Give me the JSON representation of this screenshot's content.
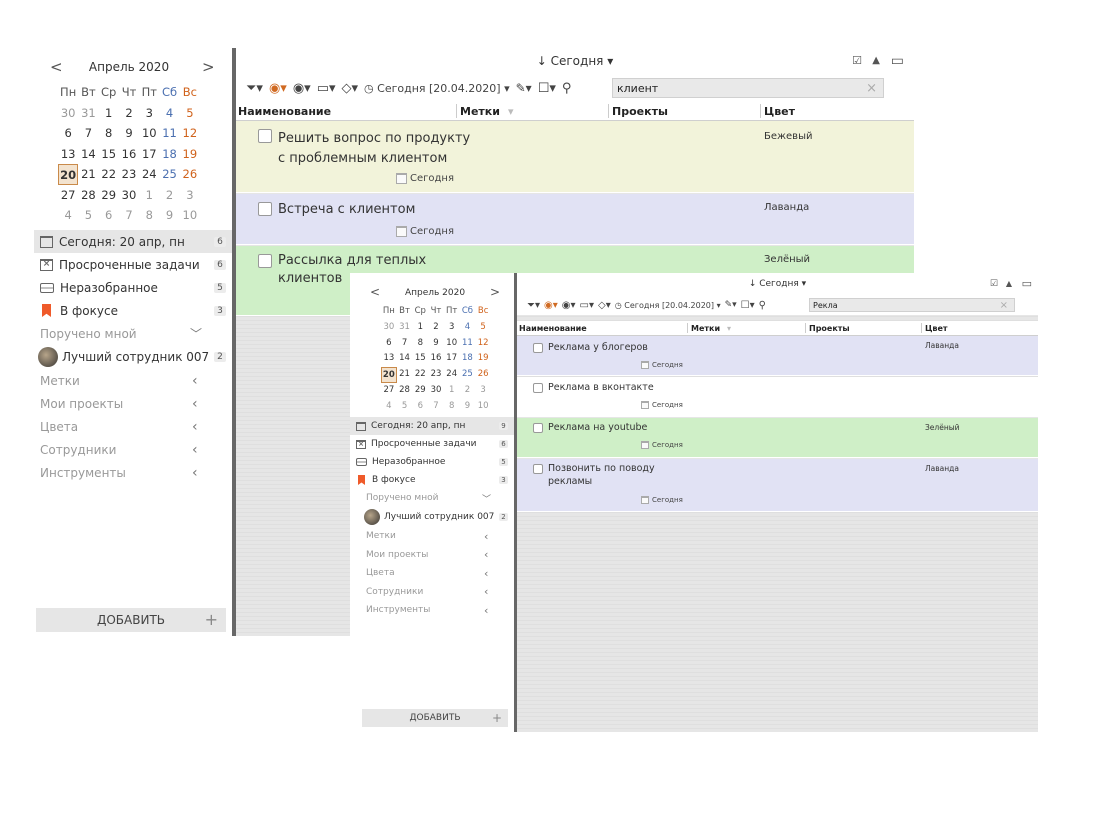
{
  "w1": {
    "calendar": {
      "month": "Апрель 2020",
      "weekdays": [
        "Пн",
        "Вт",
        "Ср",
        "Чт",
        "Пт",
        "Сб",
        "Вс"
      ],
      "weeks": [
        [
          "30",
          "31",
          "1",
          "2",
          "3",
          "4",
          "5"
        ],
        [
          "6",
          "7",
          "8",
          "9",
          "10",
          "11",
          "12"
        ],
        [
          "13",
          "14",
          "15",
          "16",
          "17",
          "18",
          "19"
        ],
        [
          "20",
          "21",
          "22",
          "23",
          "24",
          "25",
          "26"
        ],
        [
          "27",
          "28",
          "29",
          "30",
          "1",
          "2",
          "3"
        ],
        [
          "4",
          "5",
          "6",
          "7",
          "8",
          "9",
          "10"
        ]
      ],
      "today": "20"
    },
    "nav": {
      "today": {
        "label": "Сегодня: 20 апр, пн",
        "count": "6"
      },
      "overdue": {
        "label": "Просроченные задачи",
        "count": "6"
      },
      "inbox": {
        "label": "Неразобранное",
        "count": "5"
      },
      "focus": {
        "label": "В фокусе",
        "count": "3"
      },
      "assigned": "Поручено мной",
      "employee": {
        "label": "Лучший сотрудник 007",
        "count": "2"
      },
      "tags": "Метки",
      "projects": "Мои проекты",
      "colors": "Цвета",
      "staff": "Сотрудники",
      "tools": "Инструменты"
    },
    "add_label": "ДОБАВИТЬ",
    "header": "↓ Сегодня ▾",
    "toolbar": {
      "date_filter": "Сегодня [20.04.2020]",
      "search_value": "клиент"
    },
    "columns": {
      "name": "Наименование",
      "tags": "Метки",
      "projects": "Проекты",
      "color": "Цвет"
    },
    "tasks": [
      {
        "name": "Решить вопрос по продукту\nс проблемным клиентом",
        "date": "Сегодня",
        "color": "Бежевый"
      },
      {
        "name": "Встреча с клиентом",
        "date": "Сегодня",
        "color": "Лаванда"
      },
      {
        "name": "Рассылка для теплых\nклиентов",
        "date": "",
        "color": "Зелёный"
      }
    ]
  },
  "w2": {
    "calendar": {
      "month": "Апрель 2020",
      "weekdays": [
        "Пн",
        "Вт",
        "Ср",
        "Чт",
        "Пт",
        "Сб",
        "Вс"
      ],
      "weeks": [
        [
          "30",
          "31",
          "1",
          "2",
          "3",
          "4",
          "5"
        ],
        [
          "6",
          "7",
          "8",
          "9",
          "10",
          "11",
          "12"
        ],
        [
          "13",
          "14",
          "15",
          "16",
          "17",
          "18",
          "19"
        ],
        [
          "20",
          "21",
          "22",
          "23",
          "24",
          "25",
          "26"
        ],
        [
          "27",
          "28",
          "29",
          "30",
          "1",
          "2",
          "3"
        ],
        [
          "4",
          "5",
          "6",
          "7",
          "8",
          "9",
          "10"
        ]
      ],
      "today": "20"
    },
    "nav": {
      "today": {
        "label": "Сегодня: 20 апр, пн",
        "count": "9"
      },
      "overdue": {
        "label": "Просроченные задачи",
        "count": "6"
      },
      "inbox": {
        "label": "Неразобранное",
        "count": "5"
      },
      "focus": {
        "label": "В фокусе",
        "count": "3"
      },
      "assigned": "Поручено мной",
      "employee": {
        "label": "Лучший сотрудник 007",
        "count": "2"
      },
      "tags": "Метки",
      "projects": "Мои проекты",
      "colors": "Цвета",
      "staff": "Сотрудники",
      "tools": "Инструменты"
    },
    "add_label": "ДОБАВИТЬ",
    "header": "↓ Сегодня ▾",
    "toolbar": {
      "date_filter": "Сегодня [20.04.2020]",
      "search_value": "Рекла"
    },
    "columns": {
      "name": "Наименование",
      "tags": "Метки",
      "projects": "Проекты",
      "color": "Цвет"
    },
    "tasks": [
      {
        "name": "Реклама у блогеров",
        "date": "Сегодня",
        "color": "Лаванда"
      },
      {
        "name": "Реклама в вконтакте",
        "date": "Сегодня",
        "color": ""
      },
      {
        "name": "Реклама на youtube",
        "date": "Сегодня",
        "color": "Зелёный"
      },
      {
        "name": "Позвонить по поводу\nрекламы",
        "date": "Сегодня",
        "color": "Лаванда"
      }
    ]
  }
}
